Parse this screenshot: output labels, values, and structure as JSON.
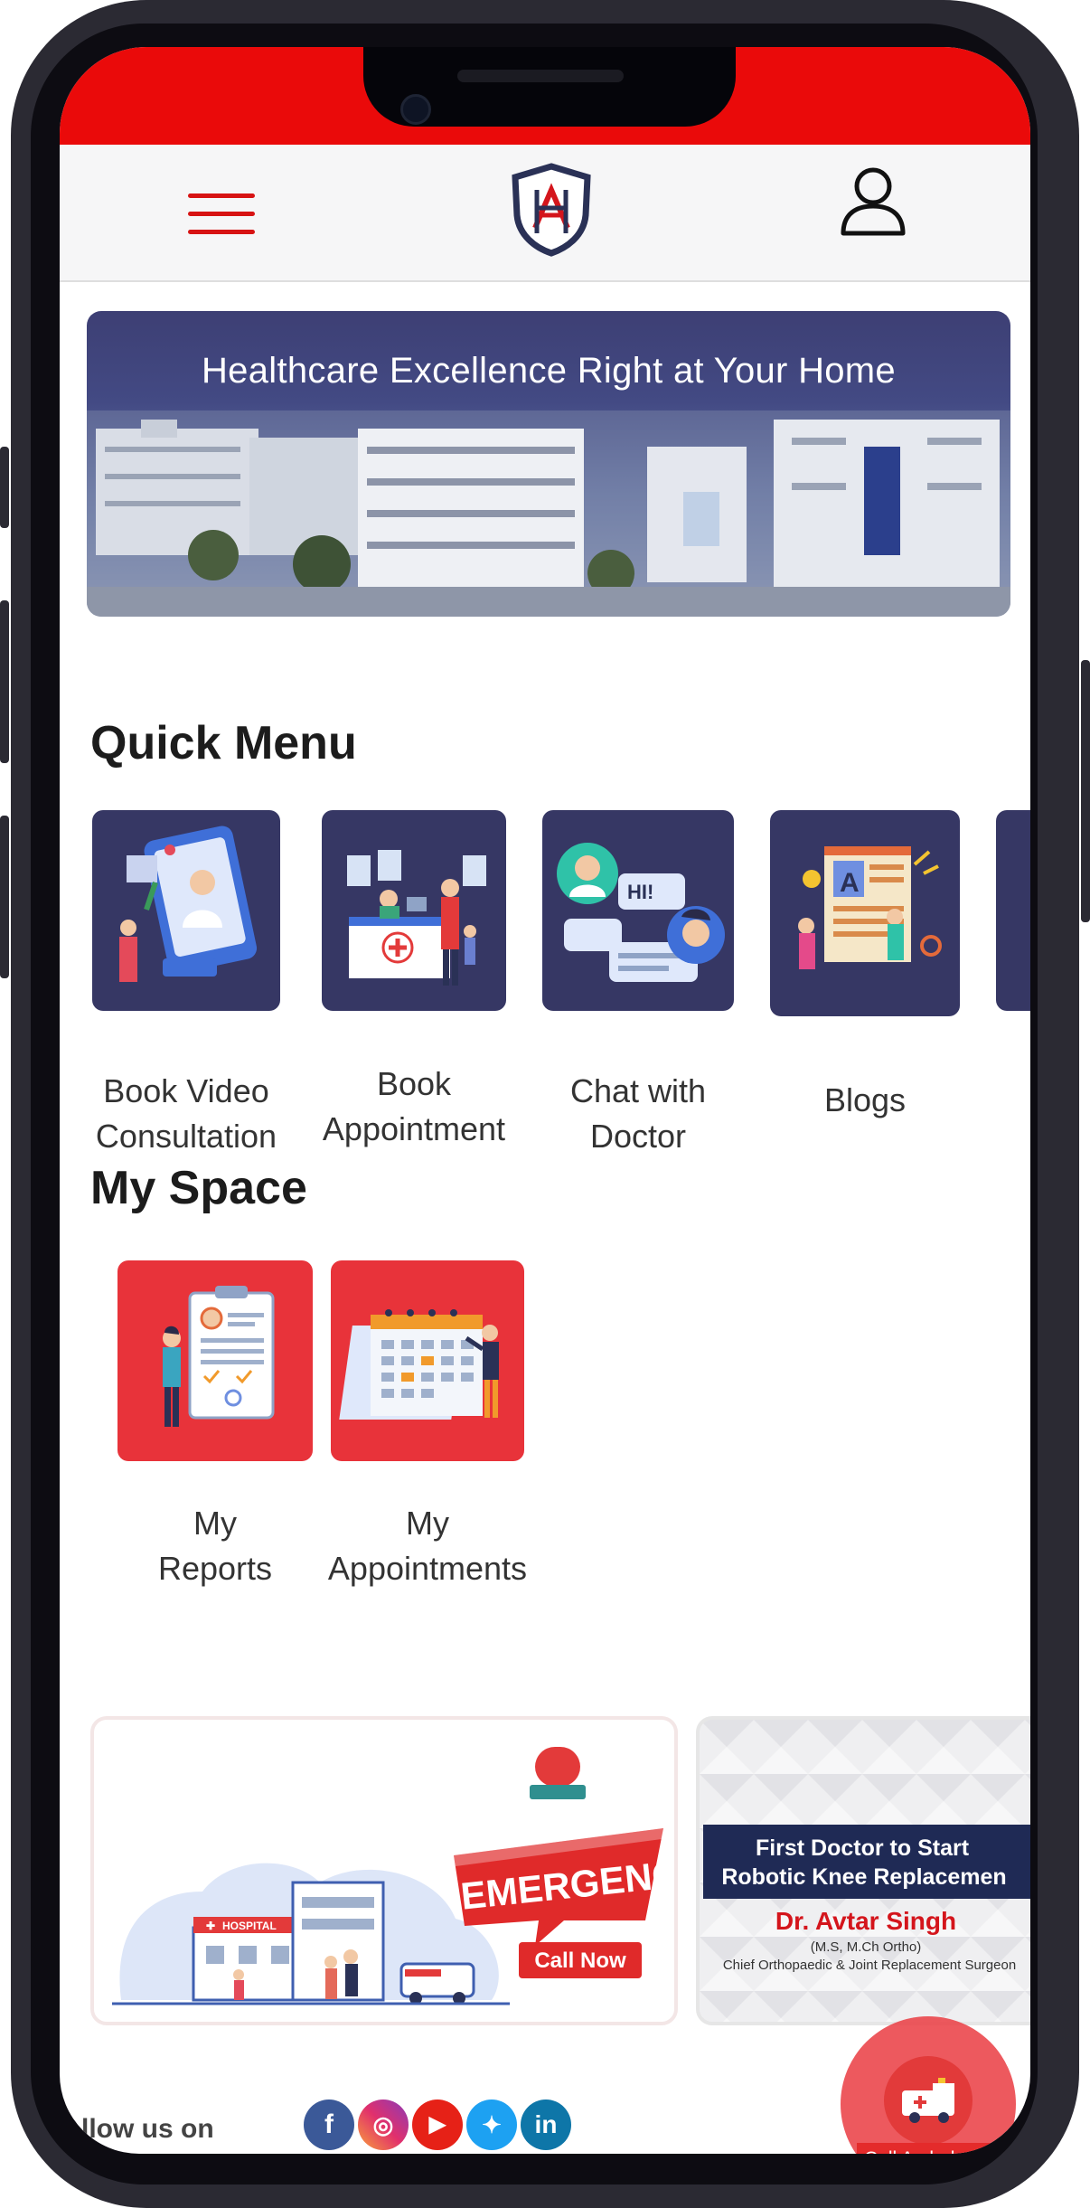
{
  "banner": {
    "title": "Healthcare Excellence Right at Your Home"
  },
  "quick_menu": {
    "title": "Quick Menu",
    "items": [
      {
        "line1": "Book Video",
        "line2": "Consultation"
      },
      {
        "line1": "Book",
        "line2": "Appointment"
      },
      {
        "line1": "Chat with",
        "line2": "Doctor"
      },
      {
        "line1": "Blogs",
        "line2": ""
      }
    ]
  },
  "my_space": {
    "title": "My Space",
    "items": [
      {
        "line1": "My",
        "line2": "Reports"
      },
      {
        "line1": "My",
        "line2": "Appointments"
      }
    ]
  },
  "promos": {
    "emergency": {
      "headline": "EMERGENCY",
      "cta": "Call Now",
      "sign": "HOSPITAL"
    },
    "doctor": {
      "headline_line1": "First Doctor to Start",
      "headline_line2": "Robotic Knee Replacemen",
      "name": "Dr. Avtar Singh",
      "qualification": "(M.S, M.Ch Ortho)",
      "role": "Chief Orthopaedic & Joint Replacement Surgeon"
    }
  },
  "footer": {
    "follow_label": "llow us on",
    "social": [
      "facebook-icon",
      "instagram-icon",
      "youtube-icon",
      "twitter-icon",
      "linkedin-icon"
    ]
  },
  "fab": {
    "label": "Call Ambulan"
  },
  "colors": {
    "brand_red": "#ea0a0a",
    "tile_navy": "#363764",
    "tile_red": "#e8333a"
  }
}
